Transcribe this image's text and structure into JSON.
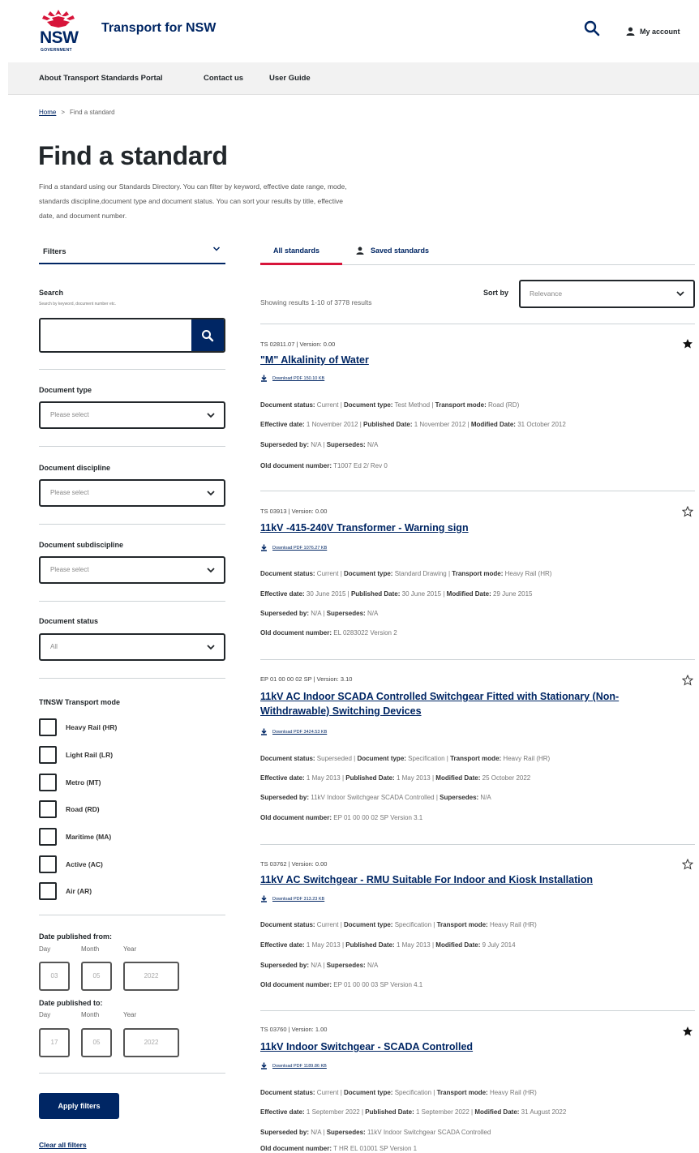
{
  "header": {
    "logo_text": "NSW",
    "logo_sub": "GOVERNMENT",
    "site_title": "Transport for NSW",
    "account_label": "My account"
  },
  "nav": {
    "items": [
      "About Transport Standards Portal",
      "Contact us",
      "User Guide"
    ]
  },
  "breadcrumb": {
    "home": "Home",
    "separator": ">",
    "current": "Find a standard"
  },
  "page": {
    "title": "Find a standard",
    "intro_lines": [
      "Find a standard using our Standards Directory. You can filter by keyword, effective date range, mode,",
      "standards discipline,document type and document status. You can sort your results by title, effective",
      "date, and document number."
    ]
  },
  "filters": {
    "heading": "Filters",
    "search_label": "Search",
    "search_hint": "Search by keyword, document number etc.",
    "search_value": "",
    "document_type_label": "Document type",
    "document_type_value": "Please select",
    "discipline_label": "Document discipline",
    "discipline_value": "Please select",
    "subdiscipline_label": "Document subdiscipline",
    "subdiscipline_value": "Please select",
    "status_label": "Document status",
    "status_value": "All",
    "mode_label": "TfNSW Transport mode",
    "modes": [
      "Heavy Rail (HR)",
      "Light Rail (LR)",
      "Metro (MT)",
      "Road (RD)",
      "Maritime (MA)",
      "Active (AC)",
      "Air (AR)"
    ],
    "date_from_label": "Date published from:",
    "date_to_label": "Date published to:",
    "day_label": "Day",
    "month_label": "Month",
    "year_label": "Year",
    "from_day": "03",
    "from_month": "05",
    "from_year": "2022",
    "to_day": "17",
    "to_month": "05",
    "to_year": "2022",
    "apply_label": "Apply filters",
    "clear_label": "Clear all filters"
  },
  "tabs": {
    "all": "All standards",
    "saved": "Saved standards"
  },
  "results_summary": "Showing results 1-10 of 3778 results",
  "sort": {
    "label": "Sort by",
    "value": "Relevance"
  },
  "labels": {
    "status": "Document status:",
    "type": "Document type:",
    "mode": "Transport mode:",
    "effective": "Effective date:",
    "published": "Published Date:",
    "modified": "Modified Date:",
    "superseded_by": "Superseded by:",
    "supersedes": "Supersedes:",
    "old_number": "Old document number:"
  },
  "results": [
    {
      "id_version": "TS 02811.07 | Version: 0.00",
      "title": "\"M\" Alkalinity of Water",
      "download": "Download PDF 150.10 KB",
      "saved": true,
      "status": "Current",
      "type": "Test Method",
      "mode": "Road (RD)",
      "effective": "1 November 2012",
      "published": "1 November 2012",
      "modified": "31 October 2012",
      "superseded_by": "N/A",
      "supersedes": "N/A",
      "old_number": "T1007 Ed 2/ Rev 0"
    },
    {
      "id_version": "TS 03913 | Version: 0.00",
      "title": "11kV -415-240V Transformer - Warning sign",
      "download": "Download PDF 1076.27 KB",
      "saved": false,
      "status": "Current",
      "type": "Standard Drawing",
      "mode": "Heavy Rail (HR)",
      "effective": "30 June 2015",
      "published": "30 June 2015",
      "modified": "29 June 2015",
      "superseded_by": "N/A",
      "supersedes": "N/A",
      "old_number": "EL 0283022 Version 2"
    },
    {
      "id_version": "EP 01 00 00 02 SP | Version: 3.10",
      "title_line1": "11kV AC Indoor SCADA Controlled Switchgear Fitted with Stationary (Non-",
      "title_line2": "Withdrawable) Switching Devices",
      "download": "Download PDF 3424.53 KB",
      "saved": false,
      "status": "Superseded",
      "type": "Specification",
      "mode": "Heavy Rail (HR)",
      "effective": "1 May 2013",
      "published": "1 May 2013",
      "modified": "25 October 2022",
      "superseded_by": "11kV Indoor Switchgear SCADA Controlled",
      "supersedes": "N/A",
      "old_number": "EP 01 00 00 02 SP Version 3.1"
    },
    {
      "id_version": "TS 03762 | Version: 0.00",
      "title": "11kV AC Switchgear - RMU Suitable For Indoor and Kiosk Installation",
      "download": "Download PDF 313.23 KB",
      "saved": false,
      "status": "Current",
      "type": "Specification",
      "mode": "Heavy Rail (HR)",
      "effective": "1 May 2013",
      "published": "1 May 2013",
      "modified": "9 July 2014",
      "superseded_by": "N/A",
      "supersedes": "N/A",
      "old_number": "EP 01 00 00 03 SP Version 4.1"
    },
    {
      "id_version": "TS 03760 | Version: 1.00",
      "title": "11kV Indoor Switchgear - SCADA Controlled",
      "download": "Download PDF 1189.86 KB",
      "saved": true,
      "status": "Current",
      "type": "Specification",
      "mode": "Heavy Rail (HR)",
      "effective": "1 September 2022",
      "published": "1 September 2022",
      "modified": "31 August 2022",
      "superseded_by": "N/A",
      "supersedes": "11kV Indoor Switchgear SCADA Controlled",
      "old_number": "T HR EL 01001 SP Version 1"
    }
  ],
  "colors": {
    "navy": "#002664",
    "red": "#d7153a"
  }
}
